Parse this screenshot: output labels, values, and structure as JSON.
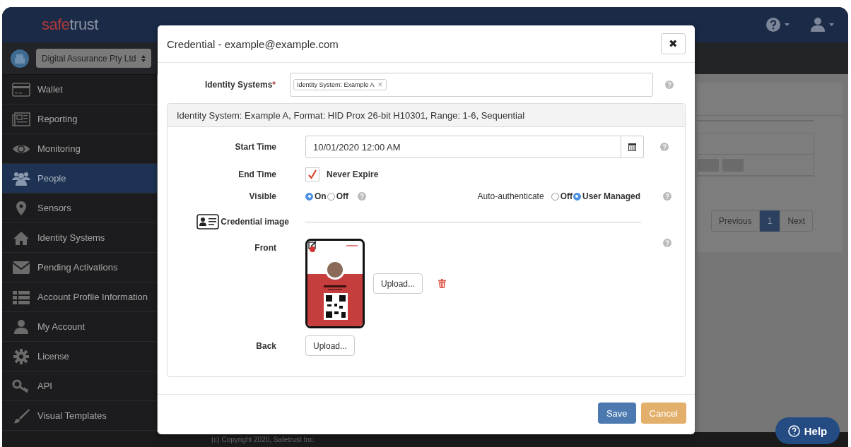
{
  "header": {
    "logo": {
      "first": "safe",
      "second": "trust"
    }
  },
  "organization_select": {
    "value": "Digital Assurance Pty Ltd"
  },
  "sidebar": {
    "items": [
      {
        "label": "Wallet",
        "selected": false
      },
      {
        "label": "Reporting",
        "selected": false
      },
      {
        "label": "Monitoring",
        "selected": false
      },
      {
        "label": "People",
        "selected": true
      },
      {
        "label": "Sensors",
        "selected": false
      },
      {
        "label": "Identity Systems",
        "selected": false
      },
      {
        "label": "Pending Activations",
        "selected": false
      },
      {
        "label": "Account Profile Information",
        "selected": false
      },
      {
        "label": "My Account",
        "selected": false
      },
      {
        "label": "License",
        "selected": false
      },
      {
        "label": "API",
        "selected": false
      },
      {
        "label": "Visual Templates",
        "selected": false
      }
    ]
  },
  "background": {
    "pagination": [
      {
        "label": "Previous",
        "selected": false
      },
      {
        "label": "1",
        "selected": true
      },
      {
        "label": "Next",
        "selected": false
      }
    ]
  },
  "footer": {
    "copyright": "(c) Copyright 2020, Safetrust Inc."
  },
  "modal": {
    "title": "Credential - example@example.com",
    "close": "✖",
    "identity_systems": {
      "label": "Identity Systems",
      "required_mark": "*",
      "tags": [
        {
          "label": "Identity System: Example A",
          "remove": "×"
        }
      ]
    },
    "panel": {
      "heading": "Identity System: Example A, Format: HID Prox 26-bit H10301, Range: 1-6, Sequential",
      "start_time": {
        "label": "Start Time",
        "value": "10/01/2020 12:00 AM"
      },
      "end_time": {
        "label": "End Time",
        "option": "Never Expire",
        "checked": true
      },
      "visible": {
        "label": "Visible",
        "options": [
          {
            "label": "On",
            "selected": true
          },
          {
            "label": "Off",
            "selected": false
          }
        ]
      },
      "auto_authenticate": {
        "label": "Auto-authenticate",
        "options": [
          {
            "label": "Off",
            "selected": false
          },
          {
            "label": "User Managed",
            "selected": true
          }
        ]
      },
      "credential_image": {
        "label": "Credential image"
      },
      "front": {
        "label": "Front",
        "button": "Upload..."
      },
      "back": {
        "label": "Back",
        "button": "Upload..."
      }
    },
    "buttons": [
      {
        "label": "Save",
        "kind": "primary"
      },
      {
        "label": "Cancel",
        "kind": "warning"
      }
    ]
  },
  "help_button": {
    "label": "Help"
  }
}
